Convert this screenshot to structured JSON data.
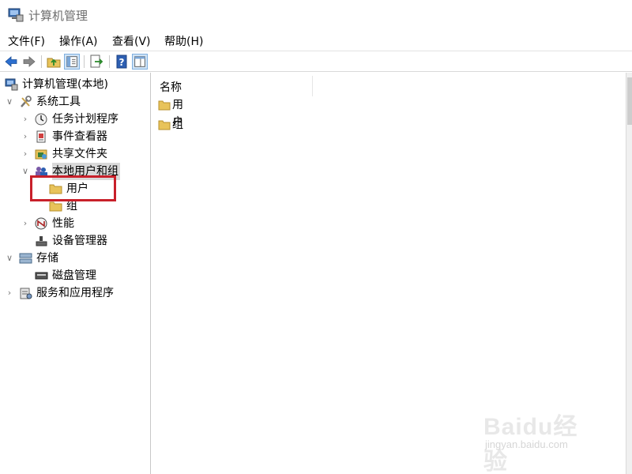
{
  "window": {
    "title": "计算机管理"
  },
  "menubar": {
    "items": [
      "文件(F)",
      "操作(A)",
      "查看(V)",
      "帮助(H)"
    ]
  },
  "toolbar": {
    "buttons": [
      "back-arrow-icon",
      "forward-arrow-icon",
      "up-folder-icon",
      "show-hide-tree-icon",
      "export-list-icon",
      "help-icon",
      "properties-pane-icon"
    ]
  },
  "tree": {
    "items": [
      {
        "label": "计算机管理(本地)",
        "level": 0,
        "expanded": true,
        "icon": "computer-management-icon"
      },
      {
        "label": "系统工具",
        "level": 1,
        "expanded": true,
        "icon": "system-tools-icon"
      },
      {
        "label": "任务计划程序",
        "level": 2,
        "expanded": false,
        "icon": "task-scheduler-icon"
      },
      {
        "label": "事件查看器",
        "level": 2,
        "expanded": false,
        "icon": "event-viewer-icon"
      },
      {
        "label": "共享文件夹",
        "level": 2,
        "expanded": false,
        "icon": "shared-folders-icon"
      },
      {
        "label": "本地用户和组",
        "level": 2,
        "expanded": true,
        "icon": "local-users-groups-icon",
        "selected": true
      },
      {
        "label": "用户",
        "level": 3,
        "icon": "folder-icon",
        "highlighted": true
      },
      {
        "label": "组",
        "level": 3,
        "icon": "folder-icon"
      },
      {
        "label": "性能",
        "level": 2,
        "expanded": false,
        "icon": "performance-icon"
      },
      {
        "label": "设备管理器",
        "level": 2,
        "icon": "device-manager-icon"
      },
      {
        "label": "存储",
        "level": 1,
        "expanded": true,
        "icon": "storage-icon"
      },
      {
        "label": "磁盘管理",
        "level": 2,
        "icon": "disk-management-icon"
      },
      {
        "label": "服务和应用程序",
        "level": 1,
        "expanded": false,
        "icon": "services-applications-icon"
      }
    ]
  },
  "list": {
    "column_header": "名称",
    "rows": [
      {
        "label": "用户",
        "icon": "folder-icon"
      },
      {
        "label": "组",
        "icon": "folder-icon"
      }
    ]
  },
  "watermark": {
    "logo": "Baidu经验",
    "url": "jingyan.baidu.com"
  },
  "colors": {
    "highlight_box": "#c8202a",
    "selection": "#d9d9d9",
    "folder": "#e8c35a"
  }
}
